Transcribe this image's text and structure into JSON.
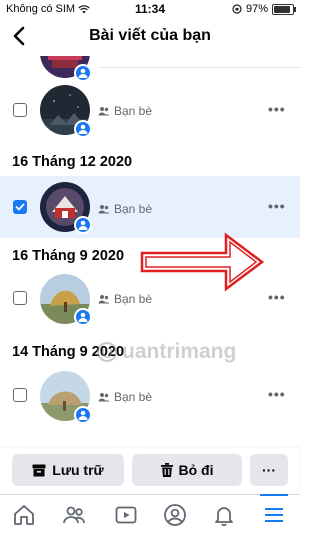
{
  "status_bar": {
    "carrier": "Không có SIM",
    "time": "11:34",
    "battery": "97%",
    "battery_level": 0.97
  },
  "header": {
    "title": "Bài viết của bạn",
    "back_icon": "chevron-left-icon"
  },
  "posts": [
    {
      "date_heading": "",
      "audience": "Bạn bè",
      "checked": false
    },
    {
      "date_heading": "16 Tháng 12 2020",
      "audience": "Bạn bè",
      "checked": true
    },
    {
      "date_heading": "16 Tháng 9 2020",
      "audience": "Bạn bè",
      "checked": false
    },
    {
      "date_heading": "14 Tháng 9 2020",
      "audience": "Bạn bè",
      "checked": false
    }
  ],
  "watermark": "uantrimang",
  "actions": {
    "archive_label": "Lưu trữ",
    "delete_label": "Bỏ đi",
    "more_label": "···"
  },
  "tabs": [
    "home-icon",
    "friends-icon",
    "watch-icon",
    "profile-icon",
    "notifications-icon",
    "menu-icon"
  ],
  "active_tab": "menu-icon",
  "colors": {
    "accent": "#1877f2",
    "selected_row_bg": "#e7f0fd",
    "arrow": "#e02020"
  }
}
